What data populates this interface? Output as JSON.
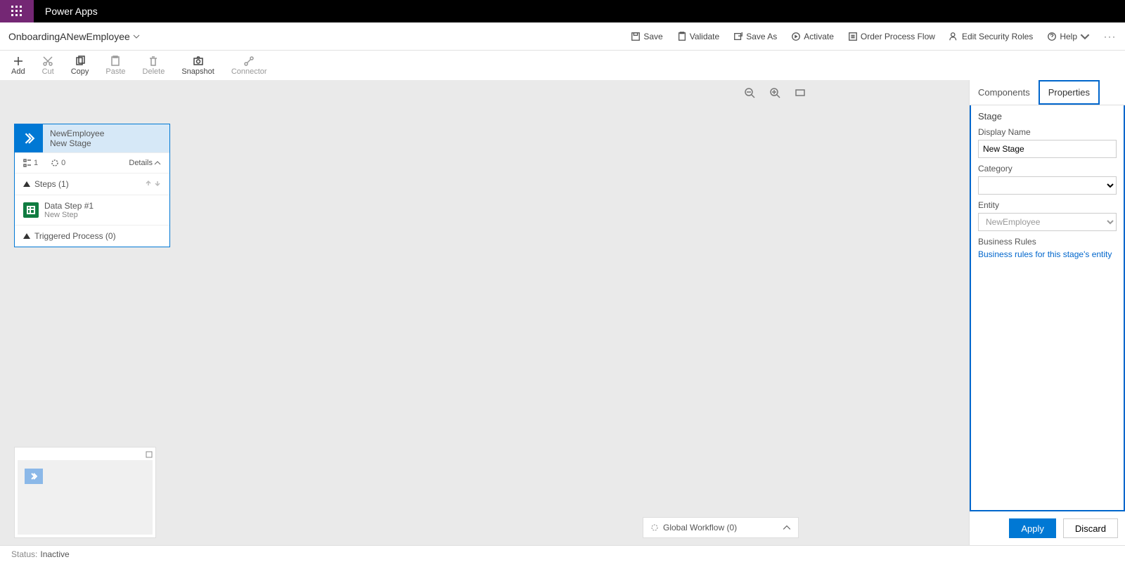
{
  "app": {
    "name": "Power Apps"
  },
  "flow": {
    "name": "OnboardingANewEmployee"
  },
  "commandBar": {
    "save": "Save",
    "validate": "Validate",
    "saveAs": "Save As",
    "activate": "Activate",
    "orderProcessFlow": "Order Process Flow",
    "editSecurityRoles": "Edit Security Roles",
    "help": "Help"
  },
  "toolbar": {
    "add": "Add",
    "cut": "Cut",
    "copy": "Copy",
    "paste": "Paste",
    "delete": "Delete",
    "snapshot": "Snapshot",
    "connector": "Connector"
  },
  "stage": {
    "entityName": "NewEmployee",
    "stageName": "New Stage",
    "stepCountBadge": "1",
    "conditionCountBadge": "0",
    "detailsLabel": "Details",
    "stepsLabel": "Steps (1)",
    "dataStepTitle": "Data Step #1",
    "dataStepSub": "New Step",
    "triggeredProcess": "Triggered Process (0)"
  },
  "globalWorkflow": {
    "label": "Global Workflow (0)"
  },
  "sideTabs": {
    "components": "Components",
    "properties": "Properties"
  },
  "propertiesPanel": {
    "heading": "Stage",
    "displayNameLabel": "Display Name",
    "displayNameValue": "New Stage",
    "categoryLabel": "Category",
    "categoryValue": "",
    "entityLabel": "Entity",
    "entityValue": "NewEmployee",
    "businessRulesLabel": "Business Rules",
    "businessRulesLink": "Business rules for this stage's entity"
  },
  "footer": {
    "apply": "Apply",
    "discard": "Discard"
  },
  "status": {
    "label": "Status:",
    "value": "Inactive"
  }
}
